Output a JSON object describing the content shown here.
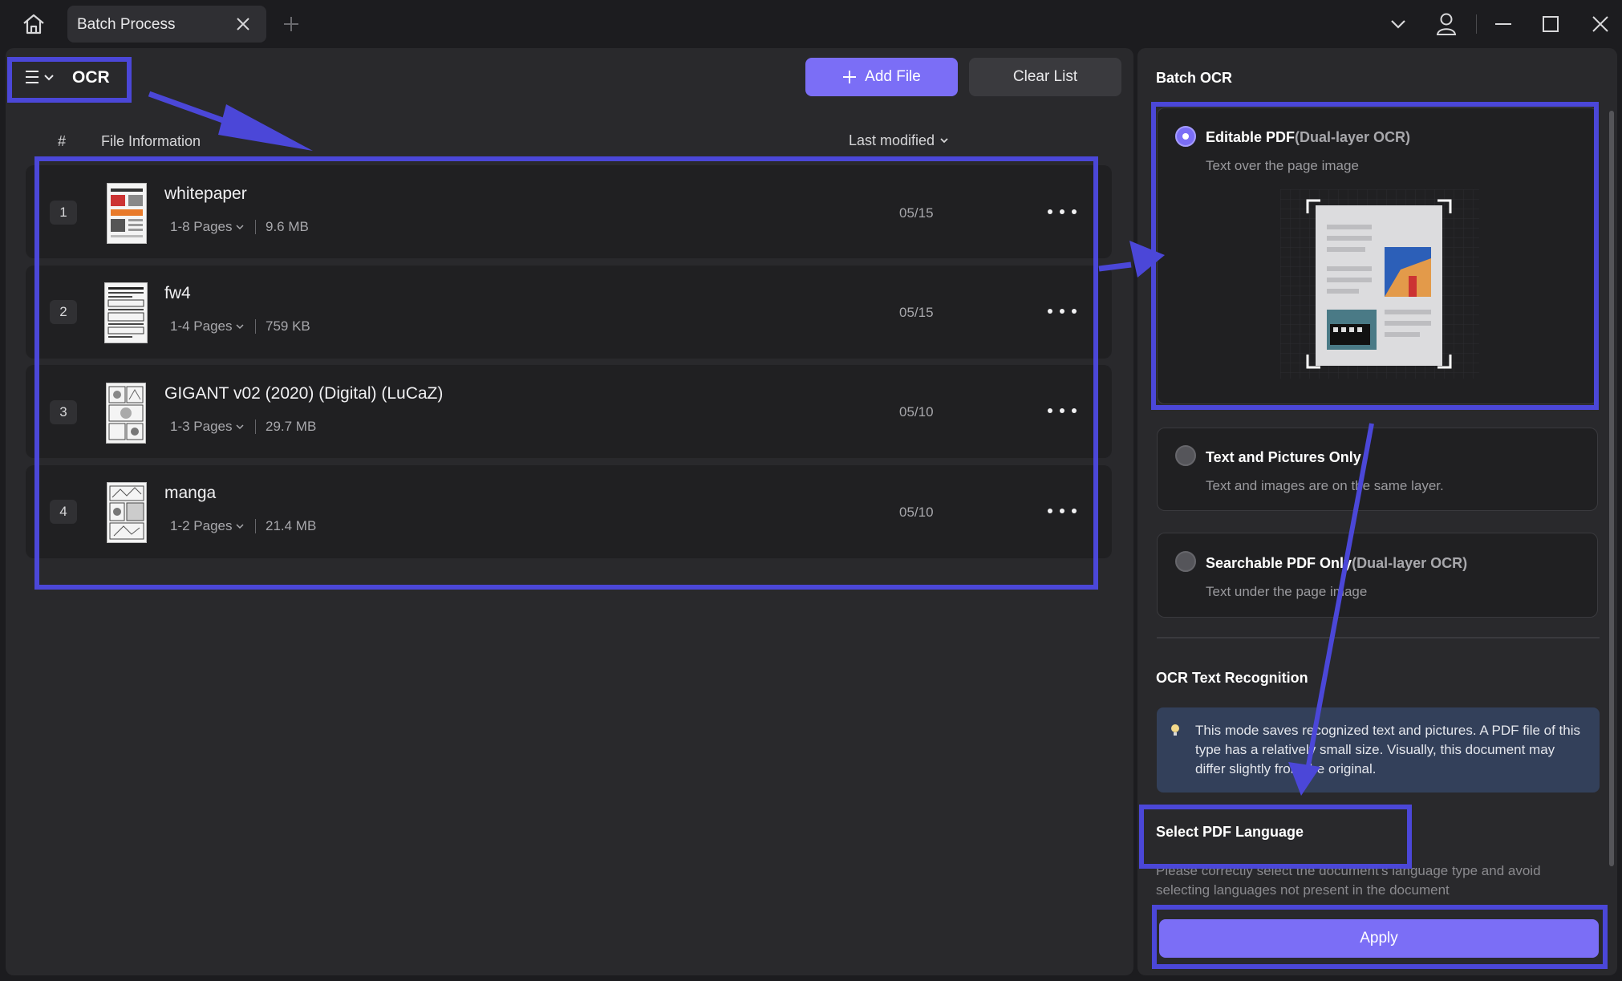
{
  "titlebar": {
    "tab_label": "Batch Process",
    "new_tab_label": "+"
  },
  "toolbar": {
    "mode_title": "OCR",
    "add_file_label": "Add File",
    "clear_list_label": "Clear List"
  },
  "list": {
    "col_number": "#",
    "col_info": "File Information",
    "col_modified": "Last modified",
    "files": [
      {
        "index": "1",
        "name": "whitepaper",
        "pages": "1-8 Pages",
        "size": "9.6 MB",
        "date": "05/15"
      },
      {
        "index": "2",
        "name": "fw4",
        "pages": "1-4 Pages",
        "size": "759 KB",
        "date": "05/15"
      },
      {
        "index": "3",
        "name": "GIGANT v02 (2020) (Digital) (LuCaZ)",
        "pages": "1-3 Pages",
        "size": "29.7 MB",
        "date": "05/10"
      },
      {
        "index": "4",
        "name": "manga",
        "pages": "1-2 Pages",
        "size": "21.4 MB",
        "date": "05/10"
      }
    ]
  },
  "batch_ocr": {
    "title": "Batch OCR",
    "options": [
      {
        "label": "Editable PDF",
        "label_sub": "(Dual-layer OCR)",
        "desc": "Text over the page image",
        "selected": true
      },
      {
        "label": "Text and Pictures Only",
        "label_sub": "",
        "desc": "Text and images are on the same layer.",
        "selected": false
      },
      {
        "label": "Searchable PDF Only",
        "label_sub": "(Dual-layer OCR)",
        "desc": "Text under the page image",
        "selected": false
      }
    ],
    "recognition_title": "OCR Text Recognition",
    "info_text": "This mode saves recognized text and pictures. A PDF file of this type has a relatively small size. Visually, this document may differ slightly from the original.",
    "language_title": "Select PDF Language",
    "language_desc": "Please correctly select the document's language type and avoid selecting languages not present in the document",
    "apply_label": "Apply"
  },
  "colors": {
    "accent": "#7b6ef6",
    "annotation": "#4b47d8",
    "panel": "#29292c",
    "background": "#1c1c1f"
  }
}
